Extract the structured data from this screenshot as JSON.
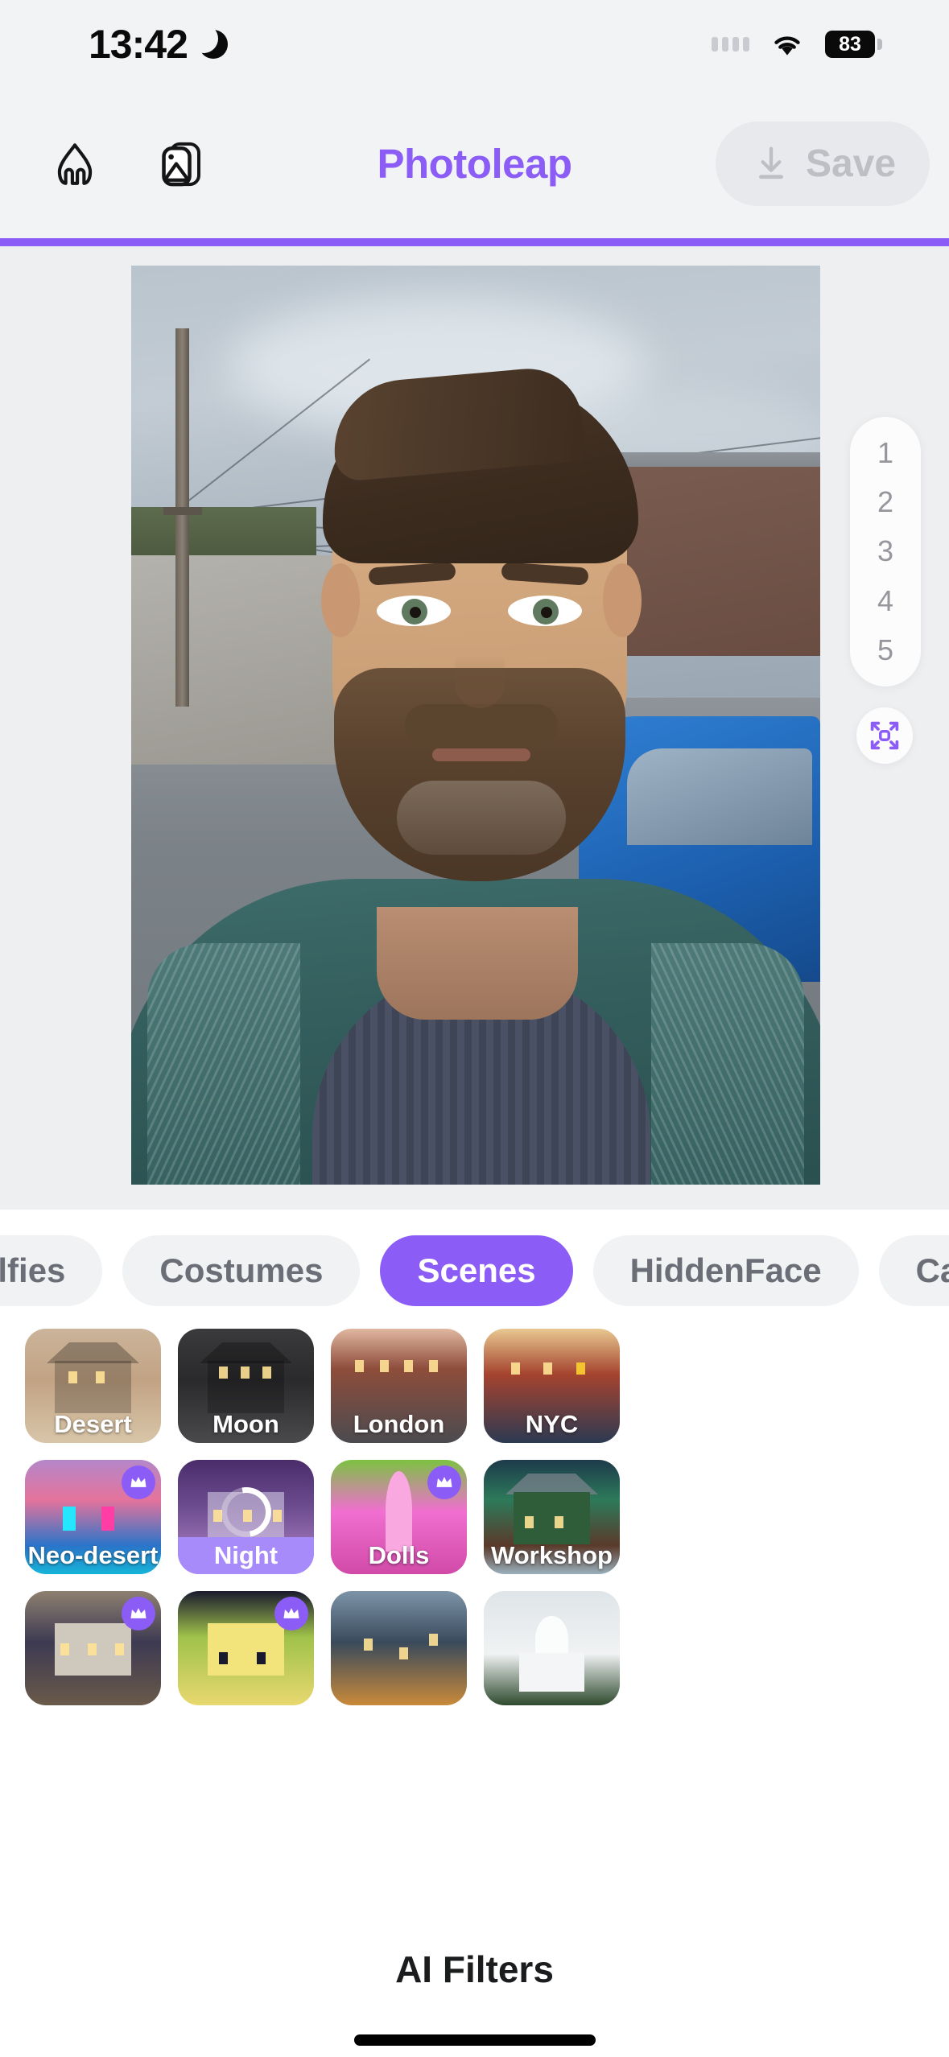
{
  "status_bar": {
    "time": "13:42",
    "dnd_icon": "crescent-moon-icon",
    "signal_dots": 4,
    "wifi_icon": "wifi-icon",
    "battery_percent": "83"
  },
  "toolbar": {
    "home_icon": "home-icon",
    "gallery_icon": "gallery-icon",
    "title": "Photoleap",
    "save_label": "Save",
    "save_icon": "download-icon",
    "save_enabled": false,
    "accent_color": "#8b5cf6"
  },
  "canvas": {
    "variation_rail": [
      "1",
      "2",
      "3",
      "4",
      "5"
    ],
    "expand_icon": "expand-fullscreen-icon",
    "photo_alt": "selfie-photo"
  },
  "tabs": [
    {
      "label": "Selfies",
      "active": false
    },
    {
      "label": "Costumes",
      "active": false
    },
    {
      "label": "Scenes",
      "active": true
    },
    {
      "label": "HiddenFace",
      "active": false
    },
    {
      "label": "Carto",
      "active": false
    }
  ],
  "grid": {
    "rows": [
      [
        {
          "label": "Desert",
          "art": "art-desert",
          "premium": false,
          "selected": false,
          "loading": false
        },
        {
          "label": "Moon",
          "art": "art-moon",
          "premium": false,
          "selected": false,
          "loading": false
        },
        {
          "label": "London",
          "art": "art-london",
          "premium": false,
          "selected": false,
          "loading": false
        },
        {
          "label": "NYC",
          "art": "art-nyc",
          "premium": false,
          "selected": false,
          "loading": false
        }
      ],
      [
        {
          "label": "Neo-desert",
          "art": "art-neodesert",
          "premium": true,
          "selected": false,
          "loading": false
        },
        {
          "label": "Night",
          "art": "art-night",
          "premium": false,
          "selected": true,
          "loading": true
        },
        {
          "label": "Dolls",
          "art": "art-dolls",
          "premium": true,
          "selected": false,
          "loading": false
        },
        {
          "label": "Workshop",
          "art": "art-workshop",
          "premium": false,
          "selected": false,
          "loading": false
        }
      ],
      [
        {
          "label": "",
          "art": "art-mountain",
          "premium": true,
          "selected": false,
          "loading": false
        },
        {
          "label": "",
          "art": "art-cartoon",
          "premium": true,
          "selected": false,
          "loading": false
        },
        {
          "label": "",
          "art": "art-castle",
          "premium": false,
          "selected": false,
          "loading": false
        },
        {
          "label": "",
          "art": "art-taj",
          "premium": false,
          "selected": false,
          "loading": false
        }
      ]
    ]
  },
  "section_title": "AI Filters"
}
